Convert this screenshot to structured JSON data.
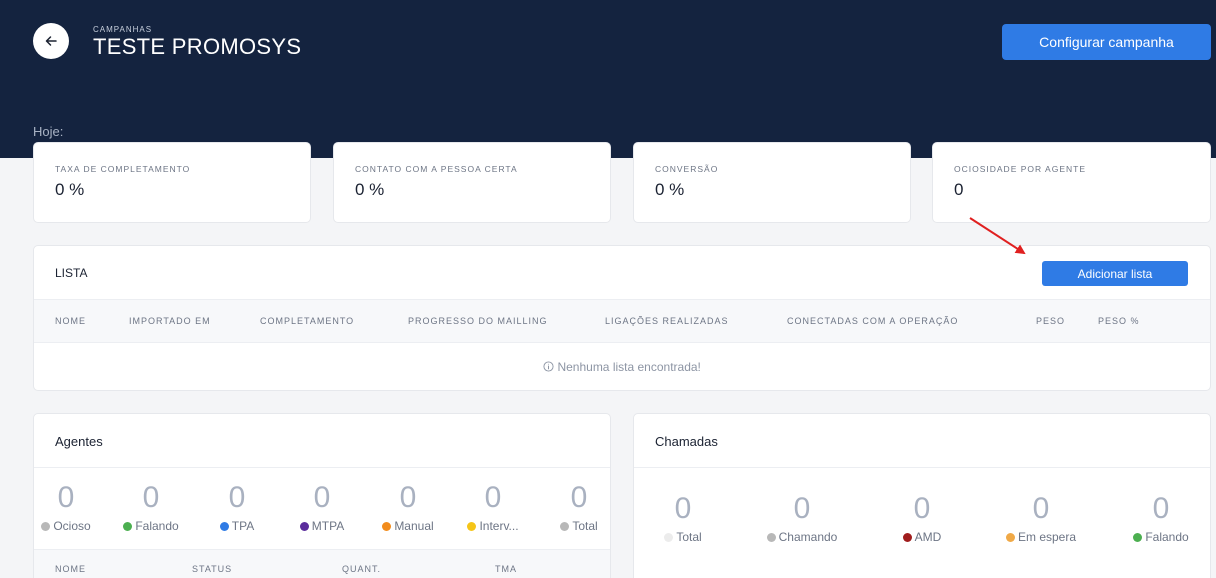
{
  "header": {
    "breadcrumb": "CAMPANHAS",
    "title": "TESTE PROMOSYS",
    "configure_label": "Configurar campanha",
    "back_icon": "arrow-left-icon"
  },
  "today_label": "Hoje:",
  "kpis": [
    {
      "label": "TAXA DE COMPLETAMENTO",
      "value": "0 %"
    },
    {
      "label": "CONTATO COM A PESSOA CERTA",
      "value": "0 %"
    },
    {
      "label": "CONVERSÃO",
      "value": "0 %"
    },
    {
      "label": "OCIOSIDADE POR AGENTE",
      "value": "0"
    }
  ],
  "lista": {
    "title": "LISTA",
    "add_label": "Adicionar lista",
    "columns": [
      "NOME",
      "IMPORTADO EM",
      "COMPLETAMENTO",
      "PROGRESSO DO MAILLING",
      "LIGAÇÕES REALIZADAS",
      "CONECTADAS COM A OPERAÇÃO",
      "PESO",
      "PESO %"
    ],
    "empty_message": "Nenhuma lista encontrada!"
  },
  "agentes": {
    "title": "Agentes",
    "stats": [
      {
        "value": "0",
        "label": "Ocioso",
        "color": "#b8b8b8"
      },
      {
        "value": "0",
        "label": "Falando",
        "color": "#4caf50"
      },
      {
        "value": "0",
        "label": "TPA",
        "color": "#2f7be5"
      },
      {
        "value": "0",
        "label": "MTPA",
        "color": "#5b2d9c"
      },
      {
        "value": "0",
        "label": "Manual",
        "color": "#f28c1c"
      },
      {
        "value": "0",
        "label": "Interv...",
        "color": "#f5c518"
      },
      {
        "value": "0",
        "label": "Total",
        "color": "#b8b8b8"
      }
    ],
    "columns": [
      "NOME",
      "STATUS",
      "QUANT.",
      "TMA"
    ]
  },
  "chamadas": {
    "title": "Chamadas",
    "stats": [
      {
        "value": "0",
        "label": "Total",
        "color": "#ececec"
      },
      {
        "value": "0",
        "label": "Chamando",
        "color": "#b8b8b8"
      },
      {
        "value": "0",
        "label": "AMD",
        "color": "#a01d1d"
      },
      {
        "value": "0",
        "label": "Em espera",
        "color": "#f0a947"
      },
      {
        "value": "0",
        "label": "Falando",
        "color": "#4caf50"
      }
    ]
  },
  "colors": {
    "header_bg": "#14233f",
    "primary": "#2f7be5",
    "annotation": "#e02020"
  }
}
